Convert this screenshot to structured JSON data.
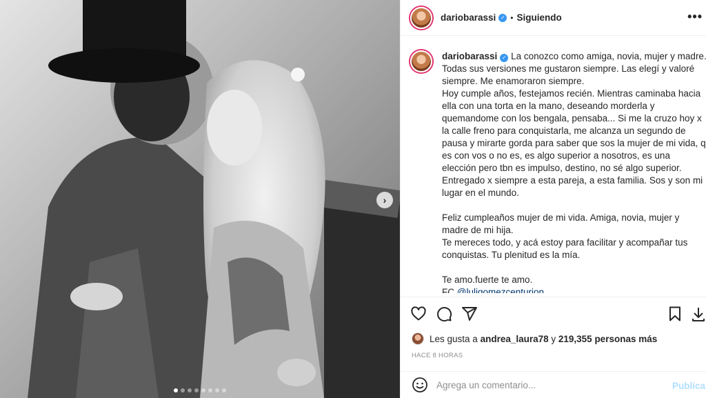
{
  "header": {
    "username": "dariobarassi",
    "separator": "•",
    "follow_status": "Siguiendo",
    "more_icon": "more-horizontal-icon"
  },
  "caption": {
    "username": "dariobarassi",
    "text": "La conozco como amiga, novia, mujer y madre. Todas sus versiones me gustaron siempre. Las elegí y valoré siempre. Me enamoraron siempre.\nHoy cumple años, festejamos recién. Mientras caminaba hacia ella con una torta en la mano, deseando morderla y quemandome con los bengala, pensaba... Si me la cruzo hoy x la calle freno para conquistarla, me alcanza un segundo de pausa y mirarte gorda para saber que sos la mujer de mi vida, q es con vos o no es, es algo superior a nosotros, es una elección pero tbn es impulso, destino, no sé algo superior.\nEntregado x siempre a esta pareja, a esta familia. Sos y son mi lugar en el mundo.\n\nFeliz cumpleaños mujer de mi vida. Amiga, novia, mujer y madre de mi hija.\nTe mereces todo, y acá estoy para facilitar y acompañar tus conquistas. Tu plenitud es la mía.\n\nTe amo.fuerte te amo.\nFC ",
    "mention": "@luligomezcenturion",
    "time": "8 h"
  },
  "actions": {
    "icons": [
      "heart-icon",
      "comment-icon",
      "share-icon",
      "bookmark-icon",
      "download-icon"
    ]
  },
  "likes": {
    "prefix": "Les gusta a ",
    "user": "andrea_laura78",
    "middle": " y ",
    "count": "219,355 personas más"
  },
  "time_ago": "HACE 8 HORAS",
  "comment": {
    "placeholder": "Agrega un comentario...",
    "publish_label": "Publicar"
  },
  "carousel": {
    "total": 8,
    "active_index": 0
  },
  "colors": {
    "accent": "#3897f0",
    "mention": "#00376b",
    "muted": "#8e8e8e",
    "publish_disabled": "#b2dffc"
  }
}
